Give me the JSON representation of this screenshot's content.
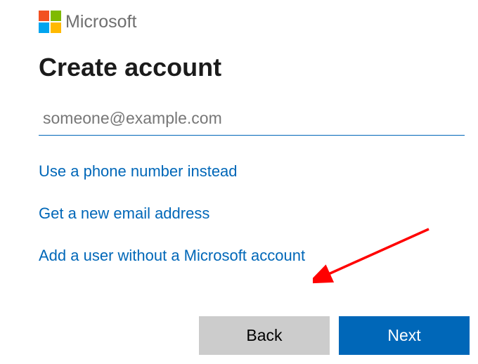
{
  "logo": {
    "text": "Microsoft"
  },
  "heading": "Create account",
  "email": {
    "placeholder": "someone@example.com",
    "value": ""
  },
  "links": {
    "phone": "Use a phone number instead",
    "newEmail": "Get a new email address",
    "noAccount": "Add a user without a Microsoft account"
  },
  "buttons": {
    "back": "Back",
    "next": "Next"
  },
  "annotation": {
    "type": "arrow",
    "color": "red",
    "target": "add-user-without-account-link"
  }
}
